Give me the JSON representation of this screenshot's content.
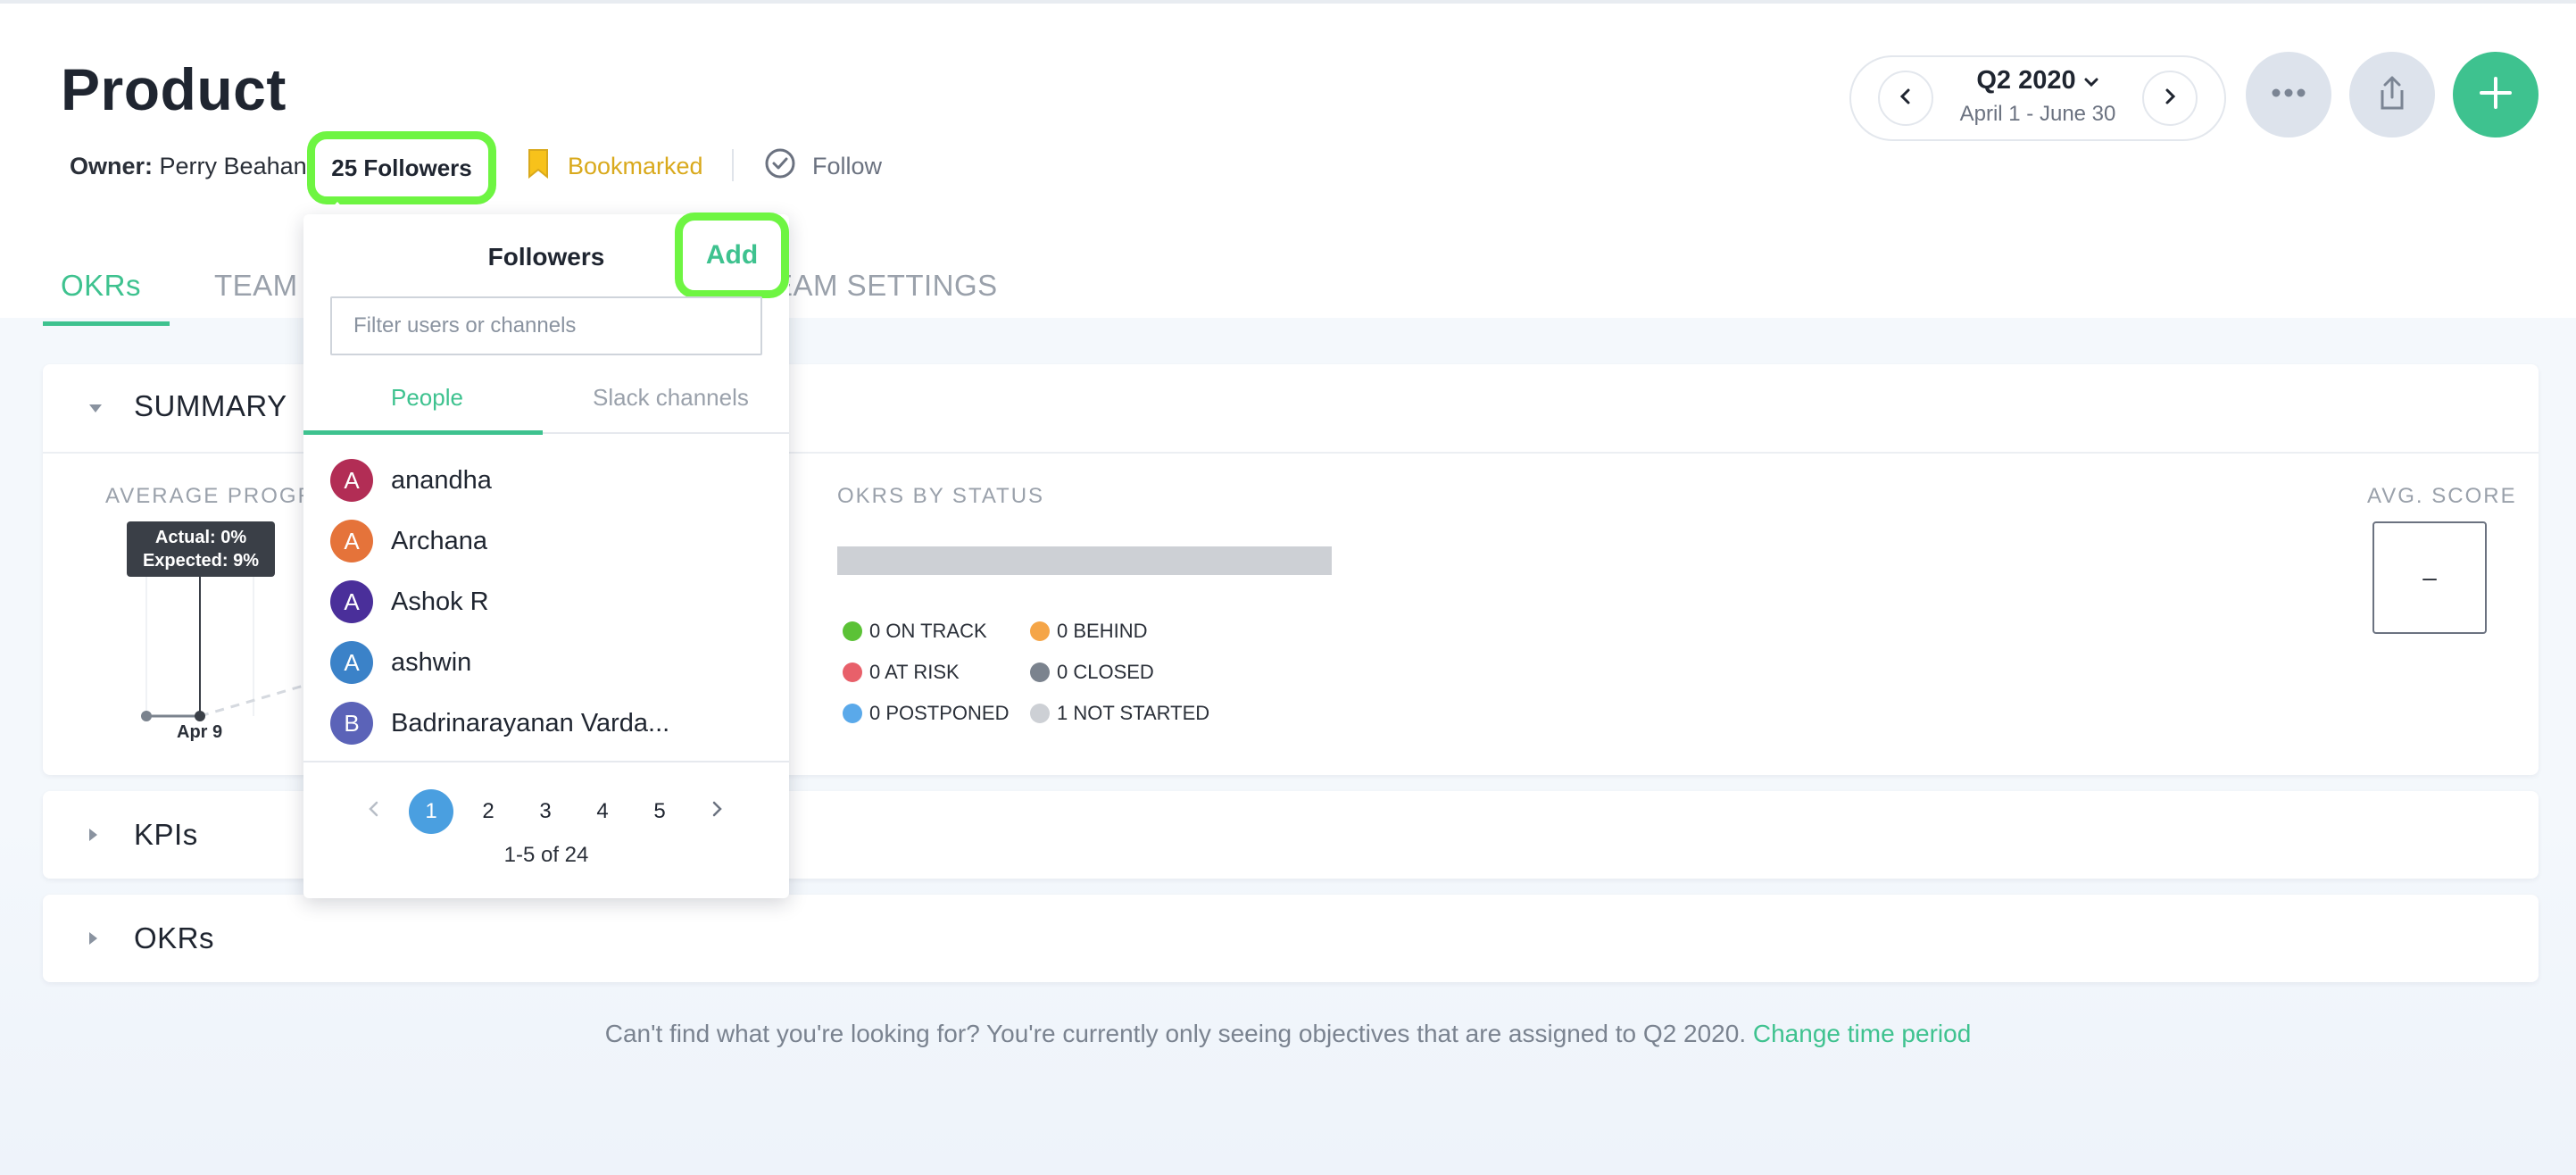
{
  "page": {
    "title": "Product",
    "owner_label": "Owner:",
    "owner_name": "Perry Beahan",
    "followers_button": "25 Followers",
    "bookmarked_label": "Bookmarked",
    "follow_label": "Follow"
  },
  "period": {
    "quarter": "Q2 2020",
    "range": "April 1 - June 30"
  },
  "tabs": [
    {
      "label": "OKRs",
      "active": true
    },
    {
      "label": "TEAM I",
      "active": false
    },
    {
      "label": "EAM SETTINGS",
      "active": false
    }
  ],
  "summary": {
    "title": "SUMMARY",
    "average_progress_label": "AVERAGE PROGR",
    "tooltip_actual": "Actual: 0%",
    "tooltip_expected": "Expected: 9%",
    "date_label": "Apr 9",
    "okrs_by_status_label": "OKRS BY STATUS",
    "avg_score_label": "AVG. SCORE",
    "avg_score_value": "–",
    "status_legend": [
      {
        "label": "0 ON TRACK",
        "color": "#5bc236"
      },
      {
        "label": "0 BEHIND",
        "color": "#f5a547"
      },
      {
        "label": "0 AT RISK",
        "color": "#e8606a"
      },
      {
        "label": "0 CLOSED",
        "color": "#7b838e"
      },
      {
        "label": "0 POSTPONED",
        "color": "#5aa9ea"
      },
      {
        "label": "1 NOT STARTED",
        "color": "#cdd0d5"
      }
    ]
  },
  "sections": {
    "kpis": "KPIs",
    "okrs": "OKRs"
  },
  "footer": {
    "message": "Can't find what you're looking for? You're currently only seeing objectives that are assigned to Q2 2020.",
    "link": "Change time period"
  },
  "popover": {
    "title": "Followers",
    "add_label": "Add",
    "filter_placeholder": "Filter users or channels",
    "tab_people": "People",
    "tab_slack": "Slack channels",
    "people": [
      {
        "initial": "A",
        "name": "anandha",
        "color": "#b22d55"
      },
      {
        "initial": "A",
        "name": "Archana",
        "color": "#e5733a"
      },
      {
        "initial": "A",
        "name": "Ashok R",
        "color": "#4a2f9a"
      },
      {
        "initial": "A",
        "name": "ashwin",
        "color": "#3b82c8"
      },
      {
        "initial": "B",
        "name": "Badrinarayanan Varda...",
        "color": "#5b63b8"
      }
    ],
    "pages": [
      "1",
      "2",
      "3",
      "4",
      "5"
    ],
    "current_page": "1",
    "count_text": "1-5 of 24"
  },
  "colors": {
    "accent": "#3ec28f",
    "highlight": "#6ef542",
    "bookmark": "#d9a91c",
    "primary_page": "#4a9fe0"
  },
  "icons": {
    "prev": "chevron-left-icon",
    "next": "chevron-right-icon",
    "more": "more-dots-icon",
    "share": "share-icon",
    "add": "plus-icon",
    "bookmark": "bookmark-icon",
    "follow": "check-circle-icon"
  }
}
